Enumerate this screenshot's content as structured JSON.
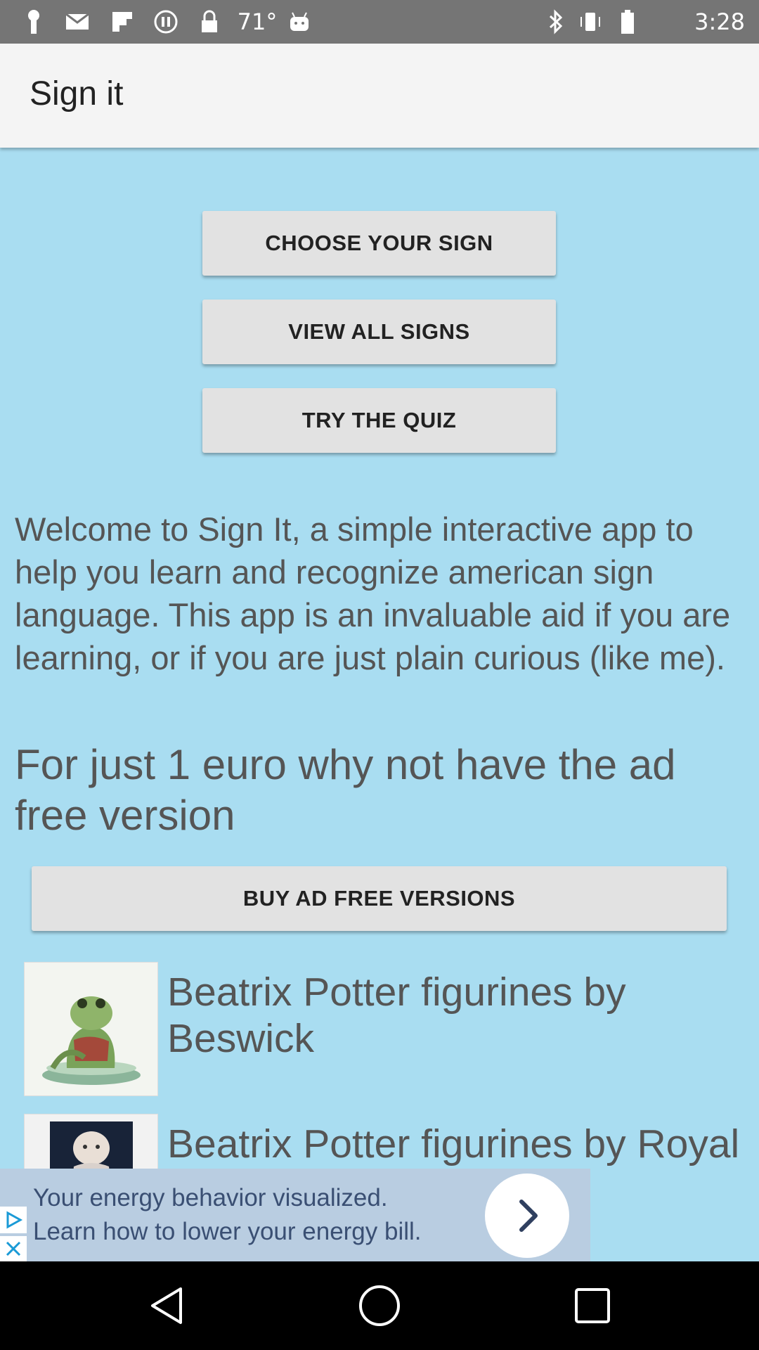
{
  "status_bar": {
    "temperature": "71°",
    "time": "3:28",
    "icons": [
      "notification-icon",
      "mail-icon",
      "flipboard-icon",
      "pause-icon",
      "lock-icon",
      "weather-temp",
      "android-icon",
      "bluetooth-icon",
      "vibrate-icon",
      "battery-icon"
    ]
  },
  "app_bar": {
    "title": "Sign it"
  },
  "menu": {
    "choose_sign": "CHOOSE YOUR SIGN",
    "view_all": "VIEW ALL SIGNS",
    "try_quiz": "TRY THE QUIZ"
  },
  "welcome_text": "Welcome to Sign It, a simple interactive app to help you learn and recognize american sign language. This app is an invaluable aid if you are learning, or if you are just plain curious (like me).",
  "promo": {
    "text": "For just 1 euro why not have the ad free version",
    "buy_label": "BUY AD FREE VERSIONS"
  },
  "list": [
    {
      "title": "Beatrix Potter figurines by Beswick",
      "icon": "frog-figurine-image"
    },
    {
      "title": "Beatrix Potter figurines by Royal",
      "icon": "figurine-image"
    }
  ],
  "ad": {
    "line1": "Your energy behavior visualized.",
    "line2": "Learn how to lower your energy bill."
  },
  "colors": {
    "background": "#a9ddf1",
    "app_bar": "#f4f4f4",
    "button": "#e2e2e2",
    "status_bar": "#757575"
  }
}
